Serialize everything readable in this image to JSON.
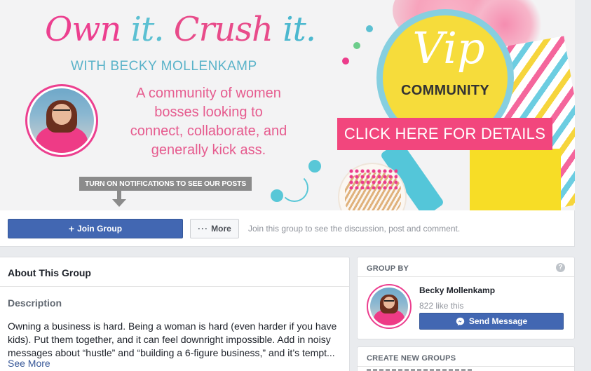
{
  "cover": {
    "title_words": [
      "Own",
      "it.",
      "Crush",
      "it."
    ],
    "byline": "WITH BECKY MOLLENKAMP",
    "tagline": "A community of women bosses looking to connect, collaborate, and generally kick ass.",
    "notification_banner": "TURN ON NOTIFICATIONS TO SEE OUR POSTS",
    "vip_text": "Vip",
    "community_text": "COMMUNITY",
    "cta_text": "CLICK HERE FOR DETAILS",
    "colors": {
      "pink": "#ec3f8f",
      "teal": "#5cc0d2",
      "yellow": "#f6dc3b",
      "cta": "#f2467d"
    }
  },
  "actions": {
    "join_label": "Join Group",
    "more_label": "More",
    "join_hint": "Join this group to see the discussion, post and comment."
  },
  "about": {
    "title": "About This Group",
    "description_label": "Description",
    "description_text": "Owning a business is hard. Being a woman is hard (even harder if you have kids). Put them together, and it can feel downright impossible. Add in noisy messages about “hustle” and “building a 6-figure business,” and it’s tempt...",
    "see_more": "See More"
  },
  "group_by": {
    "heading": "GROUP BY",
    "help_icon": "?",
    "owner_name": "Becky Mollenkamp",
    "likes": "822 like this",
    "send_message_label": "Send Message"
  },
  "create_groups": {
    "heading": "CREATE NEW GROUPS"
  },
  "icons": {
    "join": "plus-icon",
    "more": "ellipsis-icon",
    "send": "messenger-icon",
    "arrow": "down-arrow-icon"
  },
  "colors": {
    "facebook_blue": "#4267b2",
    "background": "#e9ebee",
    "link": "#385898"
  }
}
